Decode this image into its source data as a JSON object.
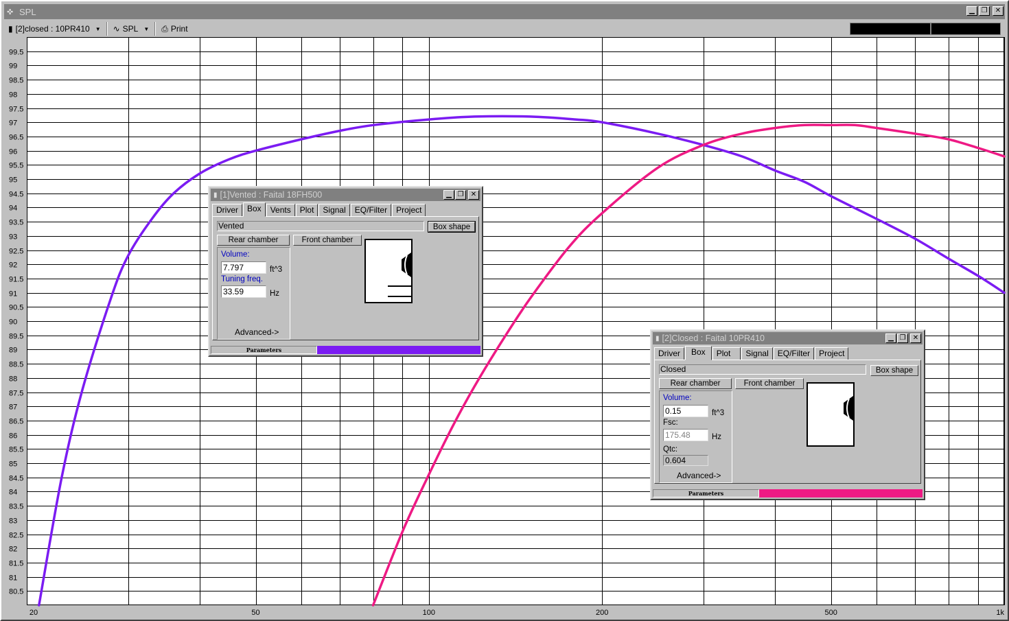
{
  "app": {
    "title": "SPL",
    "toolbar": {
      "project_select": "[2]closed : 10PR410",
      "plot_select": "SPL",
      "print_label": "Print"
    }
  },
  "colors": {
    "vented_curve": "#7b1cf2",
    "closed_curve": "#ee1a84",
    "grid": "#000000",
    "plot_bg": "#ffffff"
  },
  "chart_data": {
    "type": "line",
    "xscale": "log",
    "xlim": [
      20,
      1000
    ],
    "ylim": [
      80,
      100
    ],
    "grid": true,
    "x_ticks": [
      20,
      30,
      40,
      50,
      60,
      70,
      80,
      90,
      100,
      200,
      300,
      400,
      500,
      600,
      700,
      800,
      900,
      1000
    ],
    "x_tick_labels": [
      {
        "value": 20,
        "label": "20"
      },
      {
        "value": 50,
        "label": "50"
      },
      {
        "value": 100,
        "label": "100"
      },
      {
        "value": 200,
        "label": "200"
      },
      {
        "value": 500,
        "label": "500"
      },
      {
        "value": 1000,
        "label": "1k"
      }
    ],
    "y_tick_labels": [
      "80.5",
      "81",
      "81.5",
      "82",
      "82.5",
      "83",
      "83.5",
      "84",
      "84.5",
      "85",
      "85.5",
      "86",
      "86.5",
      "87",
      "87.5",
      "88",
      "88.5",
      "89",
      "89.5",
      "90",
      "90.5",
      "91",
      "91.5",
      "92",
      "92.5",
      "93",
      "93.5",
      "94",
      "94.5",
      "95",
      "95.5",
      "96",
      "96.5",
      "97",
      "97.5",
      "98",
      "98.5",
      "99",
      "99.5"
    ],
    "series": [
      {
        "id": "vented",
        "x": [
          21,
          23,
          25,
          28,
          30,
          33,
          36,
          40,
          45,
          50,
          60,
          70,
          80,
          100,
          120,
          150,
          180,
          200,
          250,
          300,
          350,
          400,
          450,
          500,
          600,
          700,
          800,
          900,
          1000
        ],
        "y": [
          80.0,
          84.5,
          87.6,
          90.8,
          92.3,
          93.6,
          94.5,
          95.2,
          95.7,
          96.0,
          96.4,
          96.7,
          96.9,
          97.1,
          97.2,
          97.2,
          97.1,
          97.0,
          96.6,
          96.2,
          95.8,
          95.3,
          94.9,
          94.4,
          93.6,
          92.9,
          92.2,
          91.6,
          91.0
        ]
      },
      {
        "id": "closed",
        "x": [
          80,
          90,
          100,
          110,
          120,
          135,
          150,
          175,
          200,
          250,
          300,
          350,
          400,
          450,
          500,
          550,
          600,
          700,
          800,
          900,
          1000
        ],
        "y": [
          80.0,
          82.6,
          84.6,
          86.3,
          87.7,
          89.4,
          90.8,
          92.6,
          93.8,
          95.4,
          96.2,
          96.6,
          96.8,
          96.9,
          96.9,
          96.9,
          96.8,
          96.6,
          96.4,
          96.1,
          95.8
        ]
      }
    ]
  },
  "vented_window": {
    "title": "[1]Vented : Faital  18FH500",
    "tabs": [
      "Driver",
      "Box",
      "Vents",
      "Plot",
      "Signal",
      "EQ/Filter",
      "Project"
    ],
    "box_type": "Vented",
    "box_shape_label": "Box shape",
    "rear_chamber_label": "Rear chamber",
    "front_chamber_label": "Front chamber",
    "volume_label": "Volume:",
    "volume_value": "7.797",
    "volume_unit": "ft^3",
    "tuning_label": "Tuning freq.",
    "tuning_value": "33.59",
    "tuning_unit": "Hz",
    "advanced_label": "Advanced->",
    "status_label": "Parameters"
  },
  "closed_window": {
    "title": "[2]Closed : Faital   10PR410",
    "tabs": [
      "Driver",
      "Box",
      "Plot",
      "Signal",
      "EQ/Filter",
      "Project"
    ],
    "box_type": "Closed",
    "box_shape_label": "Box shape",
    "rear_chamber_label": "Rear chamber",
    "front_chamber_label": "Front chamber",
    "volume_label": "Volume:",
    "volume_value": "0.15",
    "volume_unit": "ft^3",
    "fsc_label": "Fsc:",
    "fsc_value": "175.48",
    "fsc_unit": "Hz",
    "qtc_label": "Qtc:",
    "qtc_value": "0.604",
    "advanced_label": "Advanced->",
    "status_label": "Parameters"
  }
}
